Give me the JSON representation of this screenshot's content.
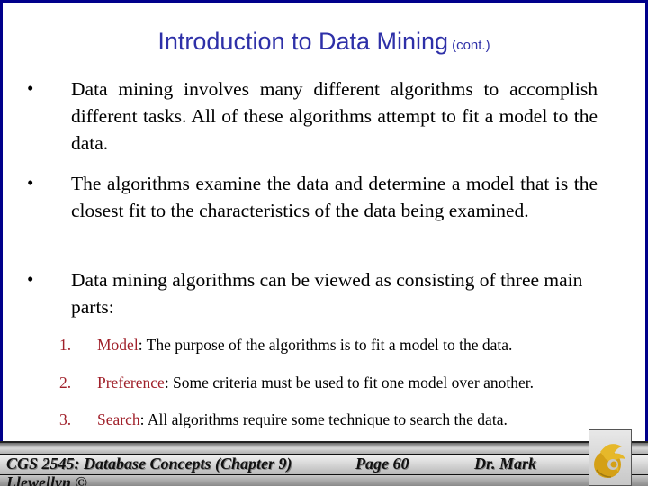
{
  "slide": {
    "title": "Introduction to Data Mining",
    "title_suffix": "(cont.)",
    "bullets": [
      "Data mining involves many different algorithms to accomplish different tasks.  All of these algorithms attempt to fit a model to the data.",
      "The algorithms examine the data and determine a model that is the closest fit to the characteristics of the data being examined.",
      "Data mining algorithms can be viewed as consisting of three main parts:"
    ],
    "bullet_glyph": "•",
    "parts": [
      {
        "number": "1.",
        "term": "Model",
        "text": ":  The purpose of the algorithms is to fit a model to the data."
      },
      {
        "number": "2.",
        "term": "Preference",
        "text": ": Some criteria must be used to fit one model over another."
      },
      {
        "number": "3.",
        "term": "Search",
        "text": ": All algorithms require some technique to search the data."
      }
    ]
  },
  "footer": {
    "course": "CGS 2545: Database Concepts  (Chapter 9)",
    "page": "Page 60",
    "author": "Dr. Mark",
    "author_cont": "Llewellyn ©",
    "logo": "ucf-pegasus-logo"
  },
  "colors": {
    "border": "#00008b",
    "title": "#2e30a8",
    "term": "#a0202a",
    "logo_gold": "#d4a017"
  }
}
